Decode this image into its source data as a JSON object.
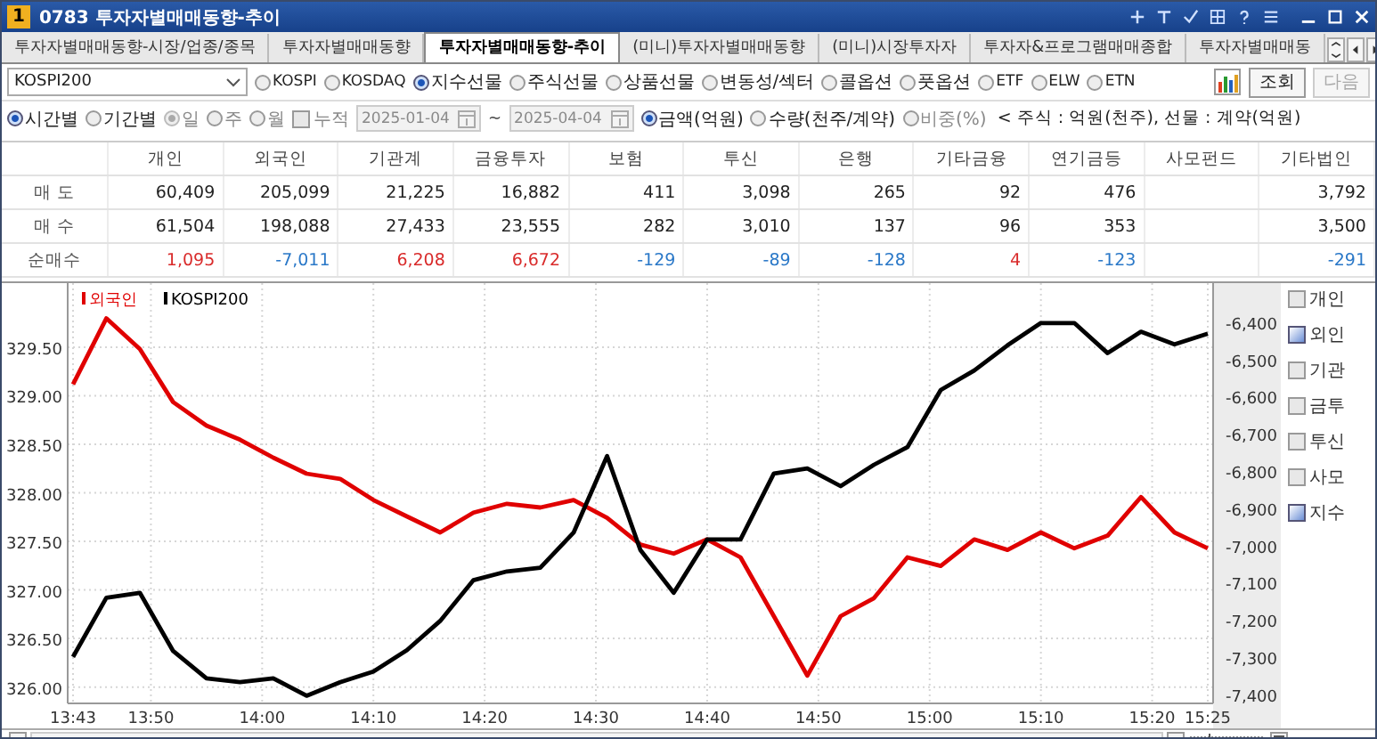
{
  "window": {
    "number": "1",
    "title": "0783 투자자별매매동향-추이"
  },
  "tabs": [
    {
      "label": "투자자별매매동향-시장/업종/종목",
      "selected": false
    },
    {
      "label": "투자자별매매동향",
      "selected": false
    },
    {
      "label": "투자자별매매동향-추이",
      "selected": true
    },
    {
      "label": "(미니)투자자별매매동향",
      "selected": false
    },
    {
      "label": "(미니)시장투자자",
      "selected": false
    },
    {
      "label": "투자자&프로그램매매종합",
      "selected": false
    },
    {
      "label": "투자자별매매동",
      "selected": false
    }
  ],
  "toolbar": {
    "market_select": {
      "value": "KOSPI200"
    },
    "markets": [
      {
        "label": "KOSPI",
        "selected": false
      },
      {
        "label": "KOSDAQ",
        "selected": false
      },
      {
        "label": "지수선물",
        "selected": true
      },
      {
        "label": "주식선물",
        "selected": false
      },
      {
        "label": "상품선물",
        "selected": false
      },
      {
        "label": "변동성/섹터",
        "selected": false
      },
      {
        "label": "콜옵션",
        "selected": false
      },
      {
        "label": "풋옵션",
        "selected": false
      },
      {
        "label": "ETF",
        "selected": false
      },
      {
        "label": "ELW",
        "selected": false
      },
      {
        "label": "ETN",
        "selected": false
      }
    ],
    "query_button": "조회",
    "next_button": {
      "label": "다음",
      "disabled": true
    }
  },
  "filters": {
    "period_modes": [
      {
        "label": "시간별",
        "selected": true
      },
      {
        "label": "기간별",
        "selected": false
      }
    ],
    "period_units": [
      {
        "label": "일",
        "selected": true,
        "disabled": true
      },
      {
        "label": "주",
        "selected": false,
        "disabled": true
      },
      {
        "label": "월",
        "selected": false,
        "disabled": true
      }
    ],
    "cumulative": {
      "label": "누적",
      "checked": false,
      "disabled": true
    },
    "start_date": {
      "value": "2025-01-04",
      "disabled": true
    },
    "date_separator": "~",
    "end_date": {
      "value": "2025-04-04",
      "disabled": true
    },
    "units": [
      {
        "label": "금액(억원)",
        "selected": true,
        "disabled": false
      },
      {
        "label": "수량(천주/계약)",
        "selected": false,
        "disabled": false
      },
      {
        "label": "비중(%)",
        "selected": false,
        "disabled": true
      }
    ],
    "unit_note": "< 주식 : 억원(천주), 선물 : 계약(억원)"
  },
  "table": {
    "columns": [
      "개인",
      "외국인",
      "기관계",
      "금융투자",
      "보험",
      "투신",
      "은행",
      "기타금융",
      "연기금등",
      "사모펀드",
      "기타법인"
    ],
    "rows": [
      {
        "label": "매 도",
        "cells": [
          {
            "value": "60,409"
          },
          {
            "value": "205,099"
          },
          {
            "value": "21,225"
          },
          {
            "value": "16,882"
          },
          {
            "value": "411"
          },
          {
            "value": "3,098"
          },
          {
            "value": "265"
          },
          {
            "value": "92"
          },
          {
            "value": "476"
          },
          null,
          {
            "value": "3,792"
          }
        ]
      },
      {
        "label": "매 수",
        "cells": [
          {
            "value": "61,504"
          },
          {
            "value": "198,088"
          },
          {
            "value": "27,433"
          },
          {
            "value": "23,555"
          },
          {
            "value": "282"
          },
          {
            "value": "3,010"
          },
          {
            "value": "137"
          },
          {
            "value": "96"
          },
          {
            "value": "353"
          },
          null,
          {
            "value": "3,500"
          }
        ]
      },
      {
        "label": "순매수",
        "cells": [
          {
            "value": "1,095",
            "color": "#d92b2b"
          },
          {
            "value": "-7,011",
            "color": "#2a78c8"
          },
          {
            "value": "6,208",
            "color": "#d92b2b"
          },
          {
            "value": "6,672",
            "color": "#d92b2b"
          },
          {
            "value": "-129",
            "color": "#2a78c8"
          },
          {
            "value": "-89",
            "color": "#2a78c8"
          },
          {
            "value": "-128",
            "color": "#2a78c8"
          },
          {
            "value": "4",
            "color": "#d92b2b"
          },
          {
            "value": "-123",
            "color": "#2a78c8"
          },
          null,
          {
            "value": "-291",
            "color": "#2a78c8"
          }
        ]
      }
    ]
  },
  "chart": {
    "chart_data": {
      "type": "line",
      "grid": true,
      "legend": "top-left",
      "x": [
        823,
        826,
        829,
        832,
        835,
        838,
        841,
        844,
        847,
        850,
        853,
        856,
        859,
        862,
        865,
        868,
        871,
        874,
        877,
        880,
        883,
        886,
        889,
        892,
        895,
        898,
        901,
        904,
        907,
        910,
        913,
        916,
        919,
        922,
        925
      ],
      "xlim": [
        823,
        925
      ],
      "xticks": [
        {
          "value": 823,
          "label": "13:43"
        },
        {
          "value": 830,
          "label": "13:50"
        },
        {
          "value": 840,
          "label": "14:00"
        },
        {
          "value": 850,
          "label": "14:10"
        },
        {
          "value": 860,
          "label": "14:20"
        },
        {
          "value": 870,
          "label": "14:30"
        },
        {
          "value": 880,
          "label": "14:40"
        },
        {
          "value": 890,
          "label": "14:50"
        },
        {
          "value": 900,
          "label": "15:00"
        },
        {
          "value": 910,
          "label": "15:10"
        },
        {
          "value": 920,
          "label": "15:20"
        },
        {
          "value": 925,
          "label": "15:25"
        }
      ],
      "ylim": [
        325.85,
        330.16
      ],
      "yticks": [
        {
          "value": 326,
          "label": "326.00"
        },
        {
          "value": 326.5,
          "label": "326.50"
        },
        {
          "value": 327,
          "label": "327.00"
        },
        {
          "value": 327.5,
          "label": "327.50"
        },
        {
          "value": 328,
          "label": "328.00"
        },
        {
          "value": 328.5,
          "label": "328.50"
        },
        {
          "value": 329,
          "label": "329.00"
        },
        {
          "value": 329.5,
          "label": "329.50"
        }
      ],
      "y2lim": [
        -7420,
        -6295
      ],
      "y2ticks": [
        {
          "value": -6400,
          "label": "-6,400"
        },
        {
          "value": -6500,
          "label": "-6,500"
        },
        {
          "value": -6600,
          "label": "-6,600"
        },
        {
          "value": -6700,
          "label": "-6,700"
        },
        {
          "value": -6800,
          "label": "-6,800"
        },
        {
          "value": -6900,
          "label": "-6,900"
        },
        {
          "value": -7000,
          "label": "-7,000"
        },
        {
          "value": -7100,
          "label": "-7,100"
        },
        {
          "value": -7200,
          "label": "-7,200"
        },
        {
          "value": -7300,
          "label": "-7,300"
        },
        {
          "value": -7400,
          "label": "-7,400"
        }
      ],
      "series": [
        {
          "name": "외국인",
          "color": "#e00000",
          "axis": "y2",
          "values": [
            -6567,
            -6390,
            -6472,
            -6615,
            -6678,
            -6716,
            -6764,
            -6807,
            -6821,
            -6878,
            -6922,
            -6965,
            -6912,
            -6888,
            -6898,
            -6878,
            -6926,
            -6998,
            -7022,
            -6984,
            -7032,
            -7190,
            -7350,
            -7190,
            -7142,
            -7032,
            -7055,
            -6984,
            -7012,
            -6965,
            -7008,
            -6974,
            -6870,
            -6965,
            -7008
          ]
        },
        {
          "name": "KOSPI200",
          "color": "#000000",
          "values": [
            326.31,
            326.92,
            326.97,
            326.37,
            326.09,
            326.05,
            326.09,
            325.91,
            326.05,
            326.16,
            326.38,
            326.68,
            327.1,
            327.19,
            327.23,
            327.59,
            328.38,
            327.41,
            326.97,
            327.52,
            327.52,
            328.2,
            328.25,
            328.07,
            328.29,
            328.47,
            329.06,
            329.26,
            329.52,
            329.75,
            329.75,
            329.44,
            329.66,
            329.53,
            329.64
          ]
        }
      ]
    },
    "series_toggles": [
      {
        "label": "개인",
        "checked": false
      },
      {
        "label": "외인",
        "checked": true
      },
      {
        "label": "기관",
        "checked": false
      },
      {
        "label": "금투",
        "checked": false
      },
      {
        "label": "투신",
        "checked": false
      },
      {
        "label": "사모",
        "checked": false
      },
      {
        "label": "지수",
        "checked": true
      }
    ]
  }
}
